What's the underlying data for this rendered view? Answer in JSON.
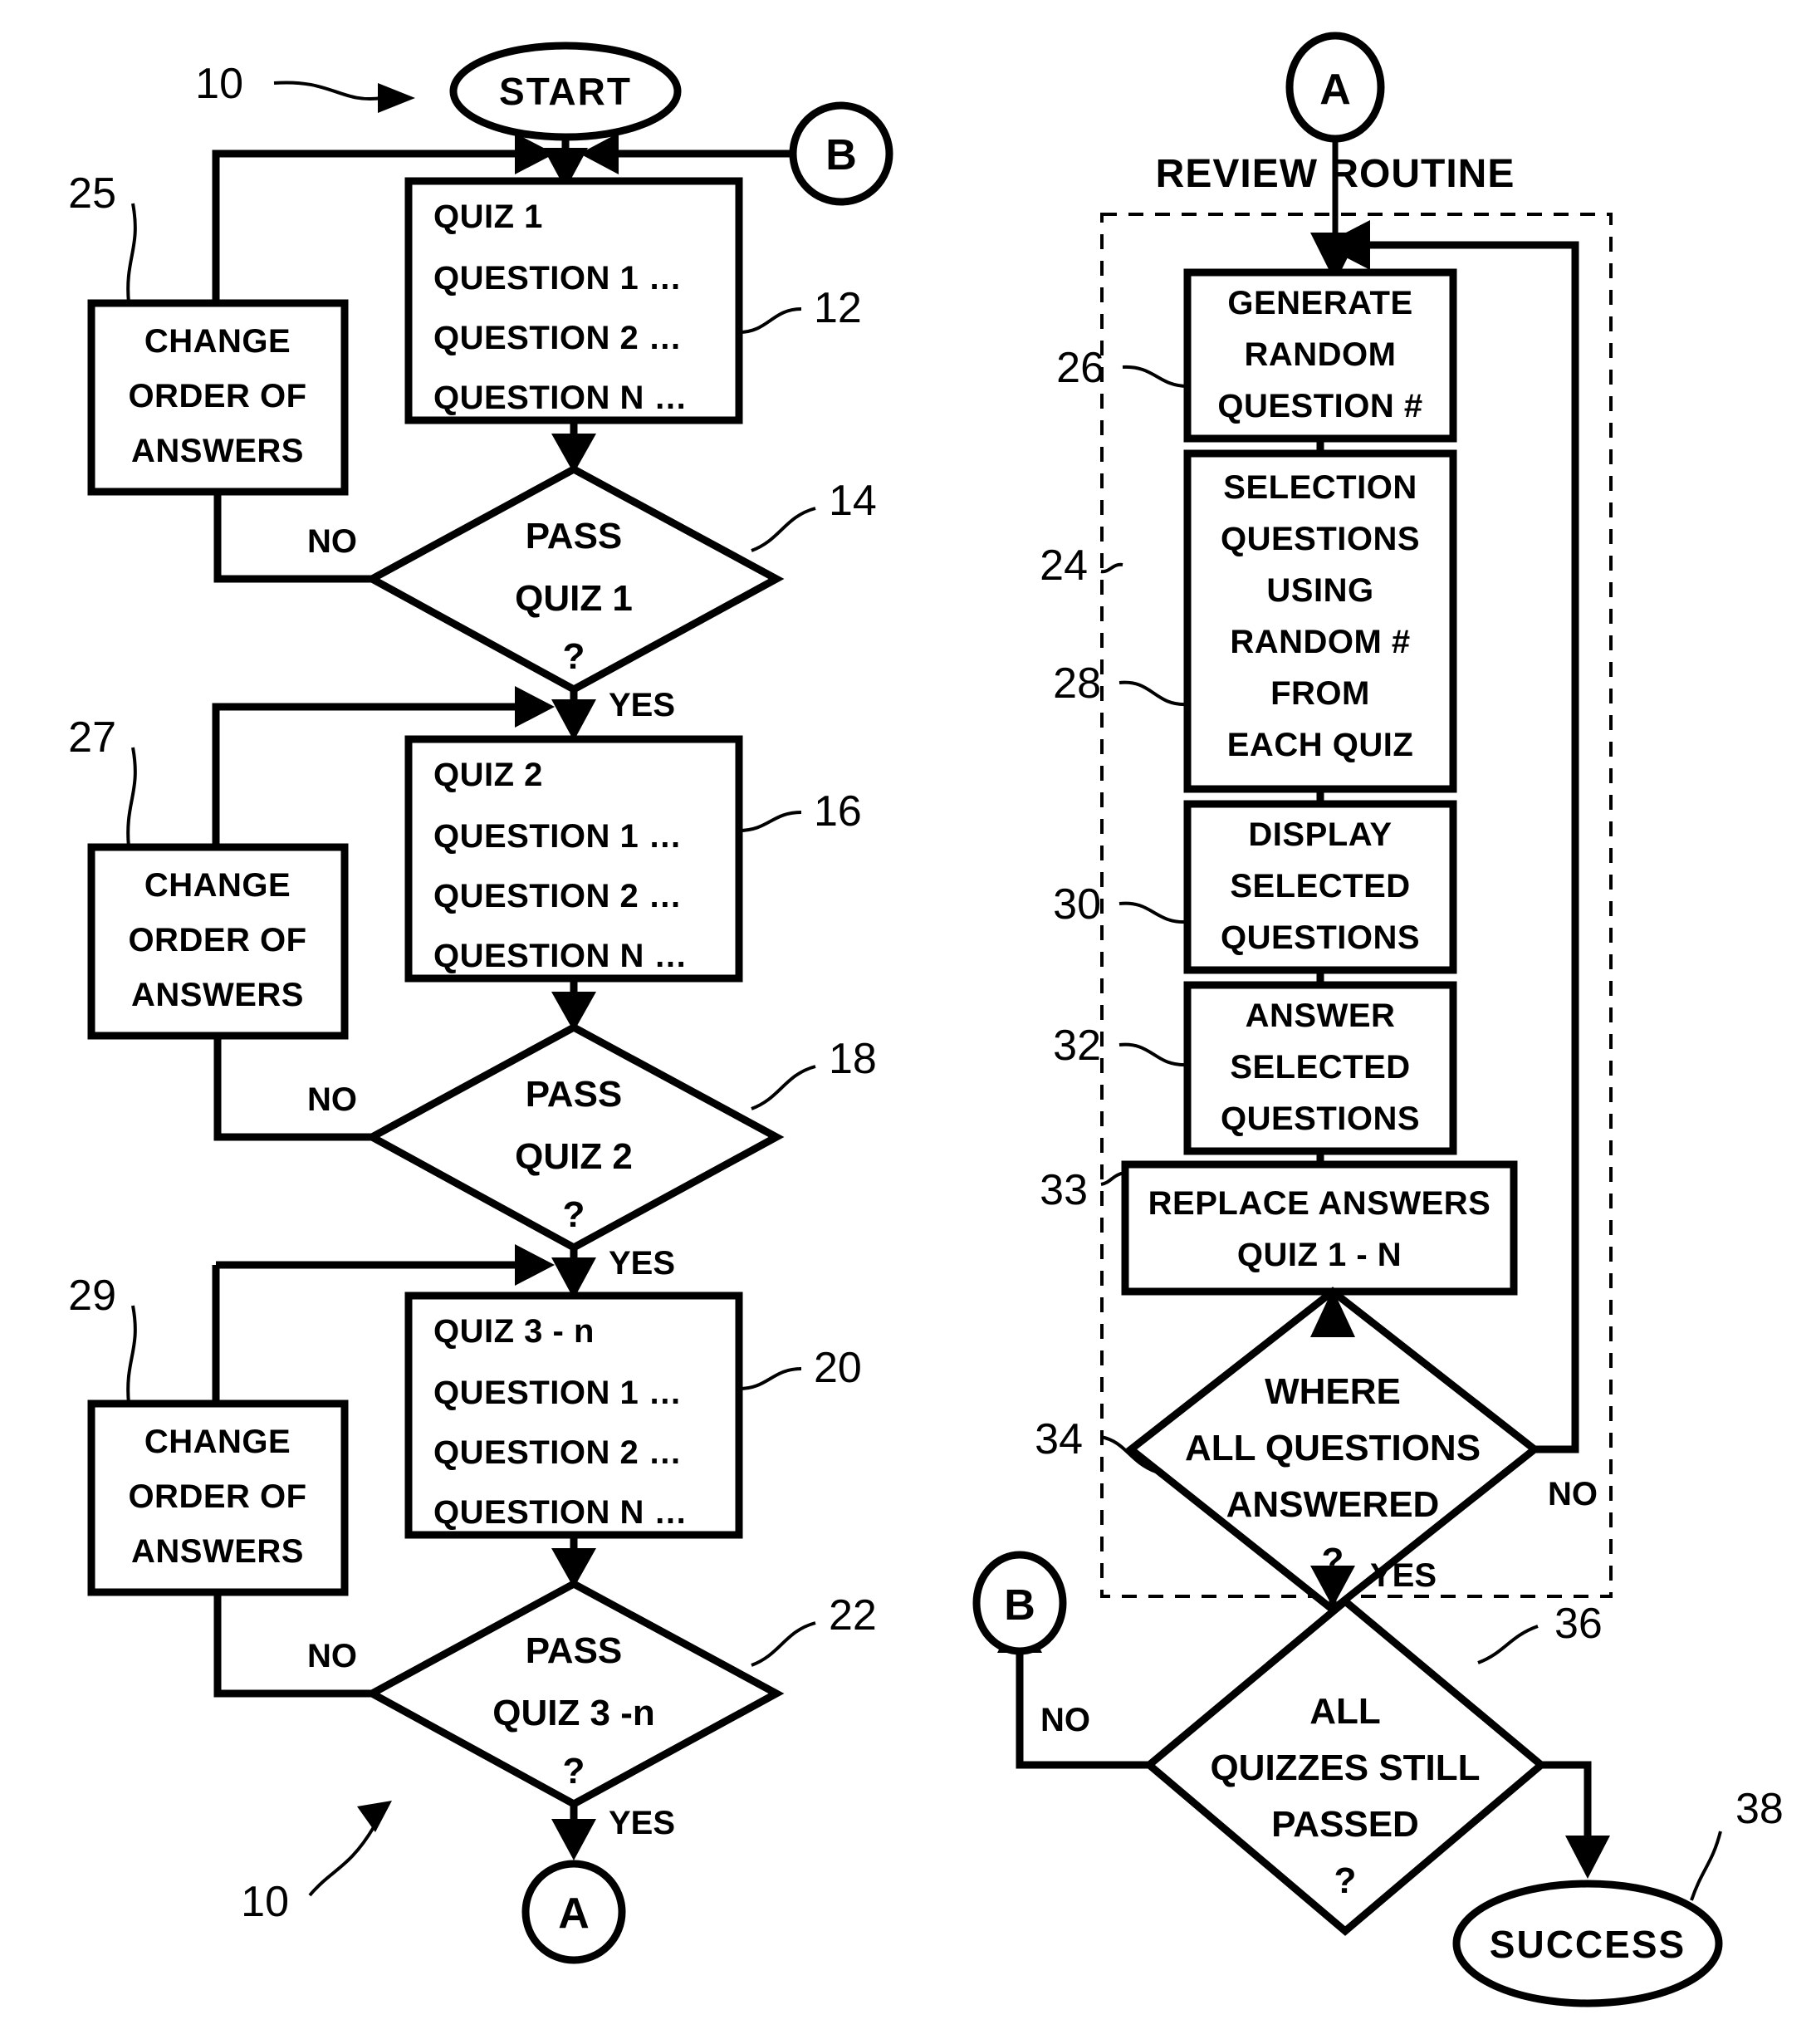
{
  "figure": {
    "type": "patent-flowchart",
    "title_label": "REVIEW ROUTINE",
    "overall_ref_top": "10",
    "overall_ref_bottom": "10"
  },
  "terminals": {
    "start": "START",
    "success": "SUCCESS"
  },
  "connectors": {
    "a_top": "A",
    "a_bottom": "A",
    "b_top": "B",
    "b_bottom": "B"
  },
  "left_column": {
    "quiz_blocks": [
      {
        "ref": "12",
        "lines": [
          "QUIZ 1",
          "QUESTION 1 …",
          "QUESTION 2 …",
          "QUESTION N …"
        ]
      },
      {
        "ref": "16",
        "lines": [
          "QUIZ 2",
          "QUESTION 1 …",
          "QUESTION 2 …",
          "QUESTION N …"
        ]
      },
      {
        "ref": "20",
        "lines": [
          "QUIZ 3 - n",
          "QUESTION 1 …",
          "QUESTION 2 …",
          "QUESTION N …"
        ]
      }
    ],
    "decisions": [
      {
        "ref": "14",
        "lines": [
          "PASS",
          "QUIZ 1",
          "?"
        ],
        "no_label": "NO",
        "yes_label": "YES"
      },
      {
        "ref": "18",
        "lines": [
          "PASS",
          "QUIZ 2",
          "?"
        ],
        "no_label": "NO",
        "yes_label": "YES"
      },
      {
        "ref": "22",
        "lines": [
          "PASS",
          "QUIZ 3 -n",
          "?"
        ],
        "no_label": "NO",
        "yes_label": "YES"
      }
    ],
    "change_boxes": [
      {
        "ref": "25",
        "lines": [
          "CHANGE",
          "ORDER OF",
          "ANSWERS"
        ]
      },
      {
        "ref": "27",
        "lines": [
          "CHANGE",
          "ORDER OF",
          "ANSWERS"
        ]
      },
      {
        "ref": "29",
        "lines": [
          "CHANGE",
          "ORDER OF",
          "ANSWERS"
        ]
      }
    ]
  },
  "right_column": {
    "process_boxes": [
      {
        "ref": "26",
        "lines": [
          "GENERATE",
          "RANDOM",
          "QUESTION #"
        ]
      },
      {
        "ref": "24",
        "ref2": "28",
        "lines": [
          "SELECTION",
          "QUESTIONS",
          "USING",
          "RANDOM #",
          "FROM",
          "EACH QUIZ"
        ]
      },
      {
        "ref": "30",
        "lines": [
          "DISPLAY",
          "SELECTED",
          "QUESTIONS"
        ]
      },
      {
        "ref": "32",
        "lines": [
          "ANSWER",
          "SELECTED",
          "QUESTIONS"
        ]
      },
      {
        "ref": "33",
        "lines": [
          "REPLACE ANSWERS",
          "QUIZ 1 - N"
        ]
      }
    ],
    "decisions": [
      {
        "ref": "34",
        "lines": [
          "WHERE",
          "ALL QUESTIONS",
          "ANSWERED",
          "?"
        ],
        "no_label": "NO",
        "yes_label": "YES"
      },
      {
        "ref": "36",
        "lines": [
          "ALL",
          "QUIZZES STILL",
          "PASSED",
          "?"
        ],
        "no_label": "NO",
        "yes_label": ""
      }
    ],
    "success_ref": "38"
  },
  "colors": {
    "ink": "#000000",
    "paper": "#ffffff"
  }
}
